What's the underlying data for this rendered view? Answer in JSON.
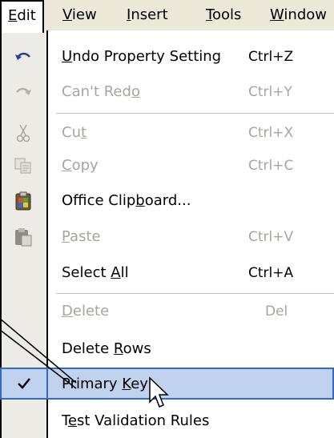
{
  "menubar": {
    "items": [
      {
        "label_u": "E",
        "label_rest": "dit"
      },
      {
        "label_u": "V",
        "label_rest": "iew"
      },
      {
        "label_u": "I",
        "label_rest": "nsert"
      },
      {
        "label_u": "T",
        "label_rest": "ools"
      },
      {
        "label_pre": "W",
        "label_u": "",
        "label_rest": "indow"
      }
    ]
  },
  "menu": {
    "items": [
      {
        "pre": "",
        "u": "U",
        "post": "ndo Property Setting",
        "shortcut": "Ctrl+Z",
        "enabled": true,
        "icon": "undo-icon"
      },
      {
        "pre": "Can't Red",
        "u": "o",
        "post": "",
        "shortcut": "Ctrl+Y",
        "enabled": false,
        "icon": "redo-icon"
      },
      {
        "pre": "Cu",
        "u": "t",
        "post": "",
        "shortcut": "Ctrl+X",
        "enabled": false,
        "icon": "scissors-icon"
      },
      {
        "pre": "",
        "u": "C",
        "post": "opy",
        "shortcut": "Ctrl+C",
        "enabled": false,
        "icon": "copy-icon"
      },
      {
        "pre": "Office Clip",
        "u": "b",
        "post": "oard...",
        "shortcut": "",
        "enabled": true,
        "icon": "office-clipboard-icon"
      },
      {
        "pre": "",
        "u": "P",
        "post": "aste",
        "shortcut": "Ctrl+V",
        "enabled": false,
        "icon": "paste-icon"
      },
      {
        "pre": "Select ",
        "u": "A",
        "post": "ll",
        "shortcut": "Ctrl+A",
        "enabled": true,
        "icon": ""
      },
      {
        "pre": "",
        "u": "D",
        "post": "elete",
        "shortcut": "Del",
        "enabled": false,
        "icon": ""
      },
      {
        "pre": "Delete ",
        "u": "R",
        "post": "ows",
        "shortcut": "",
        "enabled": true,
        "icon": ""
      },
      {
        "pre": "Primary ",
        "u": "K",
        "post": "ey",
        "shortcut": "",
        "enabled": true,
        "icon": "checkmark-icon"
      },
      {
        "pre": "T",
        "u": "e",
        "post": "st Validation Rules",
        "shortcut": "",
        "enabled": true,
        "icon": ""
      }
    ]
  },
  "colors": {
    "highlight_bg": "#c1d2ee",
    "highlight_border": "#316ac5",
    "gutter": "#ecebe6",
    "disabled_text": "#a6a59f"
  }
}
